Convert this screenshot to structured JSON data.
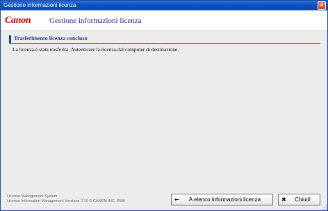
{
  "window": {
    "title": "Gestione informazioni licenza",
    "close_glyph": "✕"
  },
  "header": {
    "logo_text": "Canon",
    "app_title": "Gestione informazioni licenza",
    "brand_color": "#cc0000"
  },
  "main": {
    "section_title": "Trasferimento licenza concluso",
    "message": "La licenza è stata trasferita. Autenticare la licenza dal computer di destinazione."
  },
  "footer": {
    "product_name": "License Management System",
    "version_line": "License Information Management Versione 2.10 © CANON INC. 2006",
    "buttons": {
      "list": {
        "label": "A elenco informazioni licenza",
        "icon": "arrow-left-icon",
        "glyph": "←"
      },
      "close": {
        "label": "Chiudi",
        "icon": "close-x-icon",
        "glyph": "✖"
      }
    }
  }
}
